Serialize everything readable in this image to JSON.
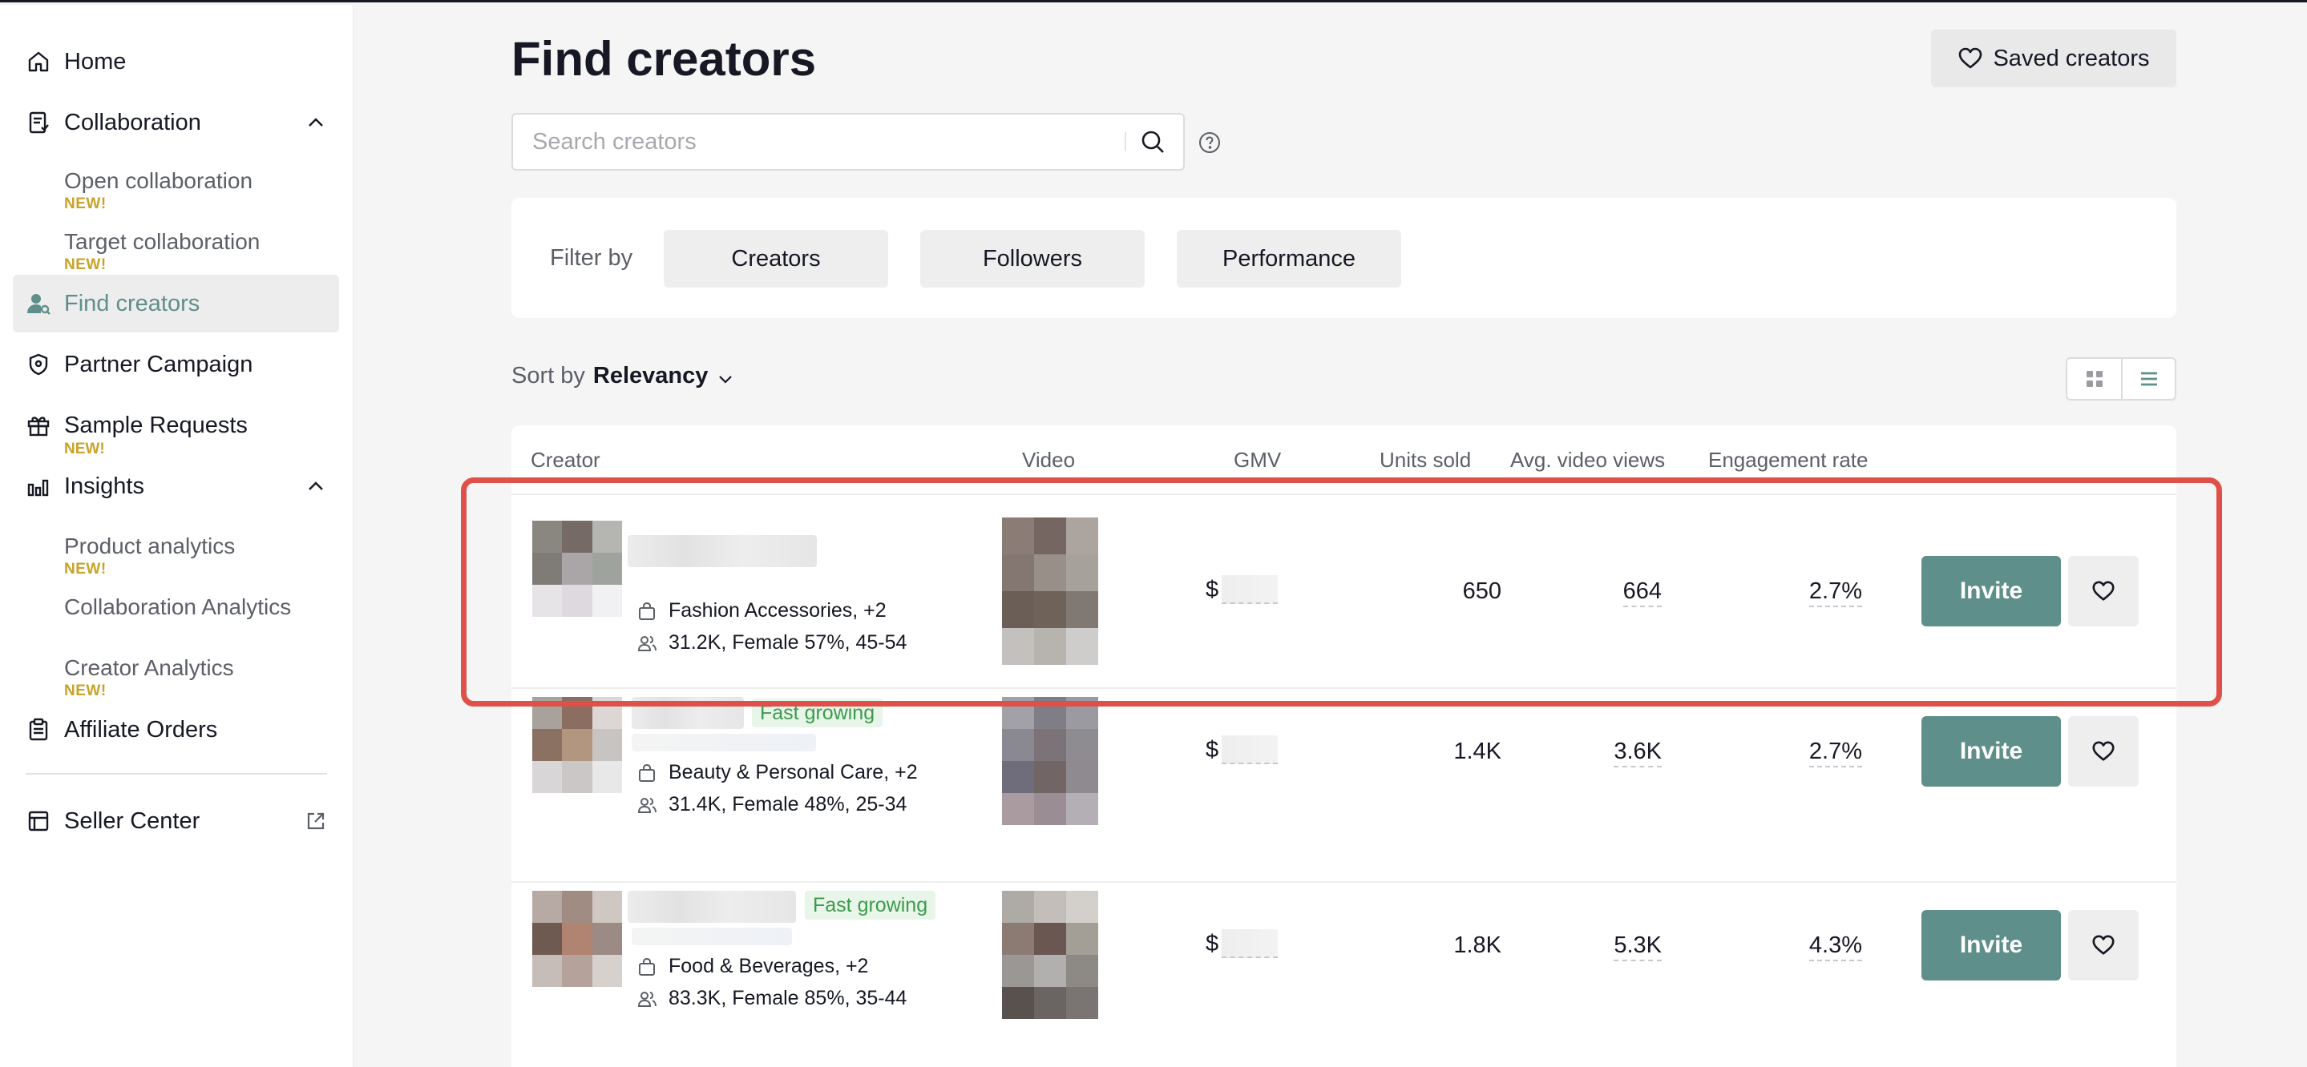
{
  "sidebar": {
    "home": "Home",
    "collaboration": "Collaboration",
    "open_collaboration": "Open collaboration",
    "target_collaboration": "Target collaboration",
    "find_creators": "Find creators",
    "partner_campaign": "Partner Campaign",
    "sample_requests": "Sample Requests",
    "insights": "Insights",
    "product_analytics": "Product analytics",
    "collaboration_analytics": "Collaboration Analytics",
    "creator_analytics": "Creator Analytics",
    "affiliate_orders": "Affiliate Orders",
    "seller_center": "Seller Center",
    "new_badge": "NEW!"
  },
  "page": {
    "title": "Find creators",
    "saved_creators": "Saved creators",
    "search_placeholder": "Search creators"
  },
  "filters": {
    "label": "Filter by",
    "creators": "Creators",
    "followers": "Followers",
    "performance": "Performance"
  },
  "sort": {
    "label": "Sort by",
    "value": "Relevancy"
  },
  "table": {
    "headers": {
      "creator": "Creator",
      "video": "Video",
      "gmv": "GMV",
      "units_sold": "Units sold",
      "avg_video_views": "Avg. video views",
      "engagement_rate": "Engagement rate"
    },
    "rows": [
      {
        "tag": "",
        "category": "Fashion Accessories, +2",
        "audience": "31.2K, Female 57%, 45-54",
        "gmv_prefix": "$",
        "units_sold": "650",
        "avg_views": "664",
        "engagement": "2.7%",
        "invite": "Invite"
      },
      {
        "tag": "Fast growing",
        "category": "Beauty & Personal Care, +2",
        "audience": "31.4K, Female 48%, 25-34",
        "gmv_prefix": "$",
        "units_sold": "1.4K",
        "avg_views": "3.6K",
        "engagement": "2.7%",
        "invite": "Invite"
      },
      {
        "tag": "Fast growing",
        "category": "Food & Beverages, +2",
        "audience": "83.3K, Female 85%, 35-44",
        "gmv_prefix": "$",
        "units_sold": "1.8K",
        "avg_views": "5.3K",
        "engagement": "4.3%",
        "invite": "Invite"
      }
    ]
  },
  "colors": {
    "accent": "#5f8f8b",
    "new_badge": "#c9a227",
    "highlight": "#e0504a",
    "tag_green": "#3e9a4d"
  }
}
